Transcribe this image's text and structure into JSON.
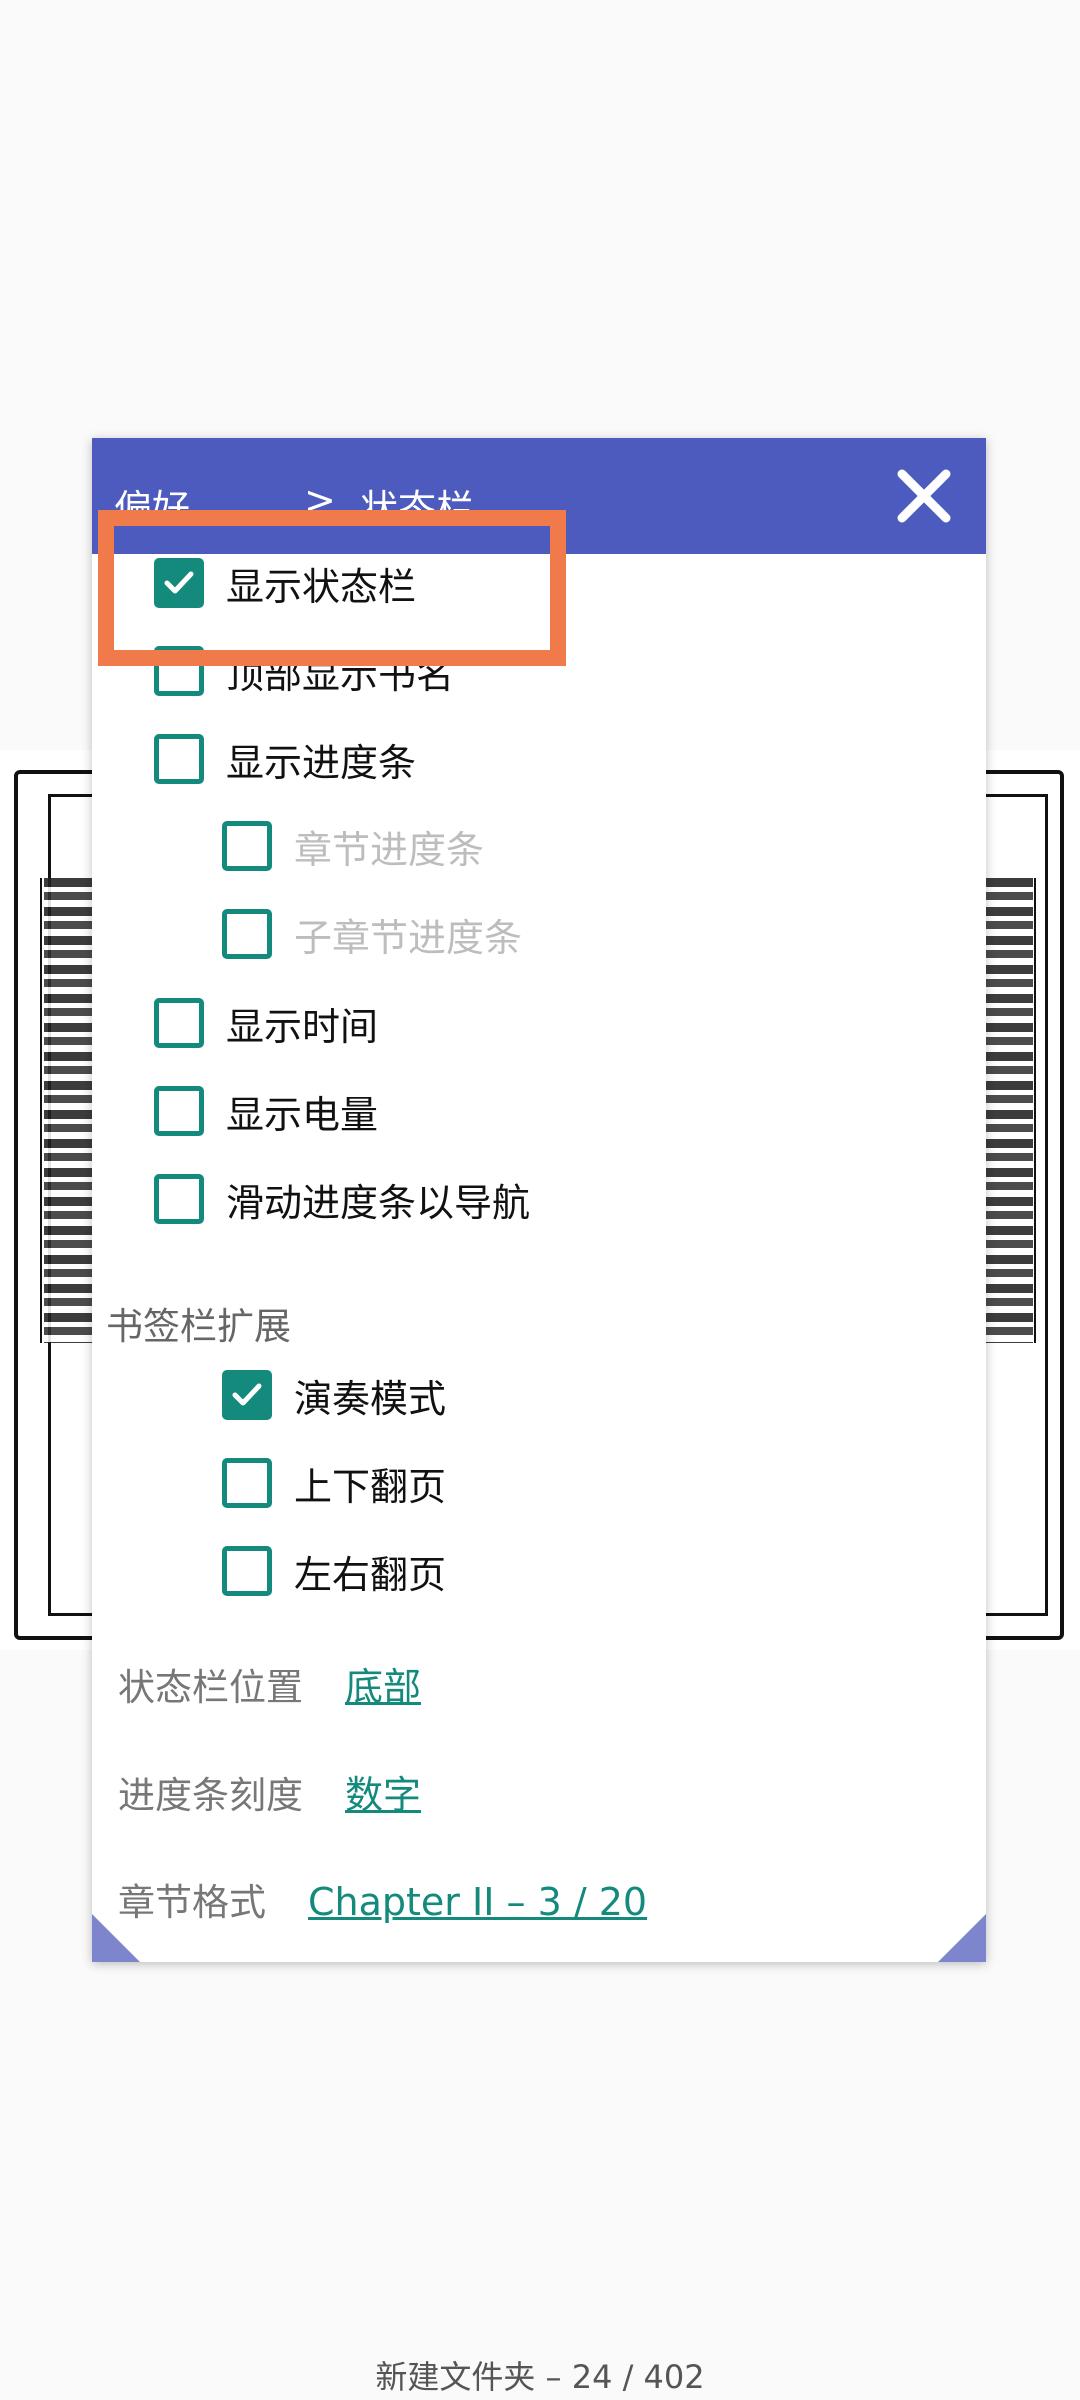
{
  "dialog": {
    "breadcrumb": {
      "parent": "偏好",
      "separator": ">",
      "current": "状态栏"
    },
    "close_icon": "close-icon"
  },
  "options": [
    {
      "label": "显示状态栏",
      "checked": true,
      "disabled": false,
      "indent": 0
    },
    {
      "label": "顶部显示书名",
      "checked": false,
      "disabled": false,
      "indent": 0
    },
    {
      "label": "显示进度条",
      "checked": false,
      "disabled": false,
      "indent": 0
    },
    {
      "label": "章节进度条",
      "checked": false,
      "disabled": true,
      "indent": 1
    },
    {
      "label": "子章节进度条",
      "checked": false,
      "disabled": true,
      "indent": 1
    },
    {
      "label": "显示时间",
      "checked": false,
      "disabled": false,
      "indent": 0
    },
    {
      "label": "显示电量",
      "checked": false,
      "disabled": false,
      "indent": 0
    },
    {
      "label": "滑动进度条以导航",
      "checked": false,
      "disabled": false,
      "indent": 0
    }
  ],
  "bookmark_section": {
    "title": "书签栏扩展",
    "options": [
      {
        "label": "演奏模式",
        "checked": true
      },
      {
        "label": "上下翻页",
        "checked": false
      },
      {
        "label": "左右翻页",
        "checked": false
      }
    ]
  },
  "settings": [
    {
      "key": "状态栏位置",
      "value": "底部"
    },
    {
      "key": "进度条刻度",
      "value": "数字"
    },
    {
      "key": "章节格式",
      "value": "Chapter II – 3 / 20"
    }
  ],
  "footer": {
    "text": "新建文件夹 – 24 / 402"
  },
  "colors": {
    "header": "#4c5bbd",
    "accent": "#138a7c",
    "highlight": "#f07a4a"
  }
}
